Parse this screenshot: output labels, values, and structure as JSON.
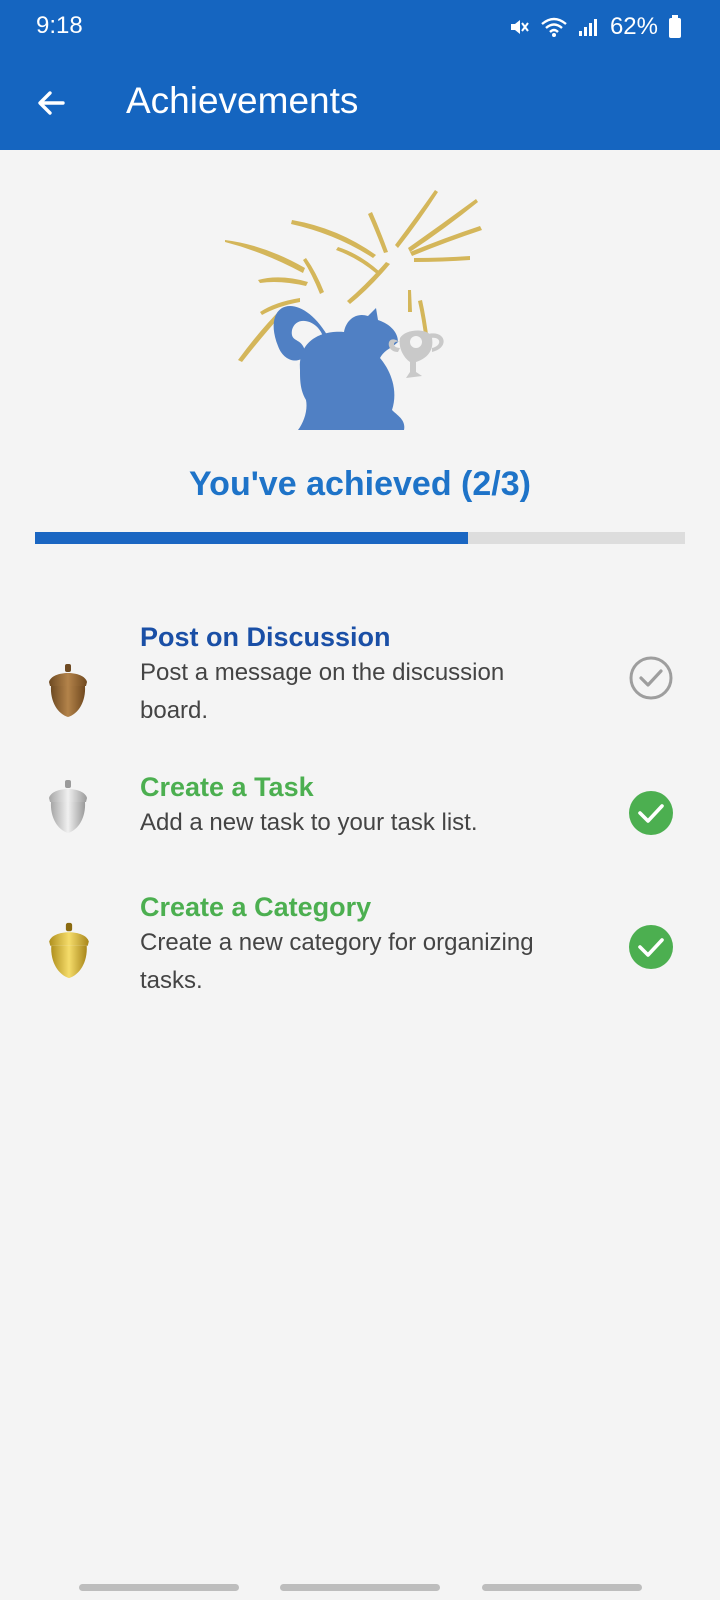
{
  "status_bar": {
    "time": "9:18",
    "battery": "62%"
  },
  "appbar": {
    "title": "Achievements",
    "back_icon": "arrow-left-icon"
  },
  "hero": {
    "illustration": "squirrel-with-trophy-fireworks"
  },
  "progress": {
    "label": "You've achieved (2/3)",
    "completed": 2,
    "total": 3
  },
  "colors": {
    "appbar": "#1565c0",
    "progress_fill": "#1a66c2",
    "progress_track": "#dddddd",
    "pending_title": "#1a4fa6",
    "done_title": "#4caf50",
    "done_check": "#4caf50",
    "pending_check": "#9e9e9e",
    "background": "#f4f4f4"
  },
  "achievements": [
    {
      "title": "Post on Discussion",
      "description_lines": [
        "Post a message on the discussion",
        "board."
      ],
      "icon": "bronze-acorn-icon",
      "completed": false
    },
    {
      "title": "Create a Task",
      "description_lines": [
        "Add a new task to your task list."
      ],
      "icon": "silver-acorn-icon",
      "completed": true
    },
    {
      "title": "Create a Category",
      "description_lines": [
        "Create a new category for organizing",
        "tasks."
      ],
      "icon": "gold-acorn-icon",
      "completed": true
    }
  ]
}
